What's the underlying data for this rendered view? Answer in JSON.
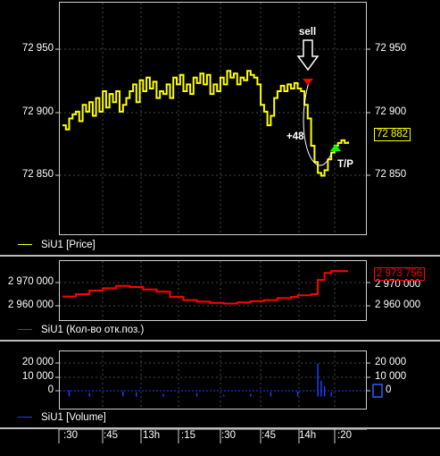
{
  "price_panel": {
    "y_labels_left": [
      "72 950",
      "72 900",
      "72 850"
    ],
    "y_labels_right": [
      "72 950",
      "72 900",
      "72 850"
    ],
    "last_price": "72 882",
    "legend": "SiU1 [Price]",
    "annotations": {
      "sell": "sell",
      "profit": "+48",
      "take_profit": "T/P"
    },
    "colors": {
      "series": "#ffff00",
      "entry_marker": "#ff0000",
      "exit_marker": "#00ff00",
      "arrow": "#ffffff"
    },
    "chart_data": {
      "type": "line",
      "x": [
        0,
        1,
        2,
        3,
        4,
        5,
        6,
        7,
        8,
        9,
        10,
        11,
        12,
        13,
        14,
        15,
        16,
        17,
        18,
        19,
        20,
        21,
        22,
        23,
        24,
        25,
        26,
        27,
        28,
        29,
        30,
        31,
        32,
        33,
        34,
        35,
        36,
        37,
        38,
        39,
        40,
        41,
        42,
        43,
        44,
        45,
        46,
        47,
        48,
        49,
        50,
        51,
        52,
        53,
        54,
        55,
        56,
        57,
        58,
        59,
        60,
        61,
        62,
        63,
        64,
        65,
        66,
        67,
        68,
        69,
        70,
        71,
        72,
        73,
        74,
        75,
        76,
        77,
        78,
        79,
        80,
        81,
        82,
        83,
        84,
        85
      ],
      "y": [
        72895,
        72892,
        72900,
        72903,
        72905,
        72898,
        72910,
        72905,
        72912,
        72902,
        72915,
        72905,
        72920,
        72908,
        72918,
        72912,
        72920,
        72905,
        72910,
        72915,
        72920,
        72925,
        72912,
        72928,
        72920,
        72930,
        72922,
        72927,
        72915,
        72920,
        72918,
        72925,
        72915,
        72930,
        72925,
        72932,
        72920,
        72925,
        72918,
        72930,
        72926,
        72933,
        72925,
        72932,
        72918,
        72925,
        72920,
        72930,
        72925,
        72935,
        72930,
        72933,
        72925,
        72930,
        72928,
        72935,
        72932,
        72930,
        72925,
        72910,
        72905,
        72895,
        72902,
        72915,
        72920,
        72924,
        72920,
        72925,
        72922,
        72926,
        72922,
        72920,
        72910,
        72900,
        72880,
        72868,
        72860,
        72858,
        72862,
        72870,
        72875,
        72880,
        72882,
        72884,
        72882,
        72883
      ],
      "ylim": [
        72815,
        72985
      ]
    }
  },
  "oi_panel": {
    "y_labels_left": [
      "2 970 000",
      "2 960 000"
    ],
    "y_labels_right": [
      "2 970 000",
      "2 960 000"
    ],
    "last_value": "2 973 756",
    "legend": "SiU1 (Кол-во отк.поз.)",
    "colors": {
      "series": "#ff0000"
    },
    "chart_data": {
      "type": "line",
      "x": [
        0,
        4,
        8,
        12,
        16,
        20,
        24,
        28,
        32,
        36,
        40,
        44,
        48,
        52,
        56,
        60,
        64,
        68,
        70,
        72,
        74,
        76,
        78,
        80,
        82,
        84,
        85
      ],
      "y": [
        2963000,
        2964000,
        2965500,
        2966500,
        2967500,
        2967000,
        2966000,
        2965000,
        2962800,
        2961500,
        2960800,
        2960300,
        2960000,
        2960500,
        2961000,
        2961500,
        2962300,
        2962800,
        2963500,
        2963500,
        2964000,
        2970000,
        2973000,
        2973800,
        2973756,
        2973756,
        2973756
      ],
      "ylim": [
        2953000,
        2978000
      ]
    }
  },
  "volume_panel": {
    "y_labels_left": [
      "20 000",
      "10 000",
      "0"
    ],
    "y_labels_right": [
      "20 000",
      "10 000",
      "0"
    ],
    "legend": "SiU1 [Volume]",
    "colors": {
      "series": "#1e3cff",
      "badge": "#2a5cff"
    },
    "chart_data": {
      "type": "bar",
      "x": [
        2,
        8,
        18,
        22,
        30,
        40,
        48,
        56,
        62,
        70,
        76,
        77,
        78,
        80
      ],
      "values": [
        3500,
        2000,
        3000,
        2500,
        1500,
        2000,
        1000,
        1500,
        2500,
        3000,
        19000,
        9000,
        6000,
        2500
      ],
      "ylim": [
        -7000,
        26000
      ]
    }
  },
  "time_axis": {
    "ticks": [
      ":30",
      ":45",
      "13h",
      ":15",
      ":30",
      ":45",
      "14h",
      ":20"
    ]
  }
}
